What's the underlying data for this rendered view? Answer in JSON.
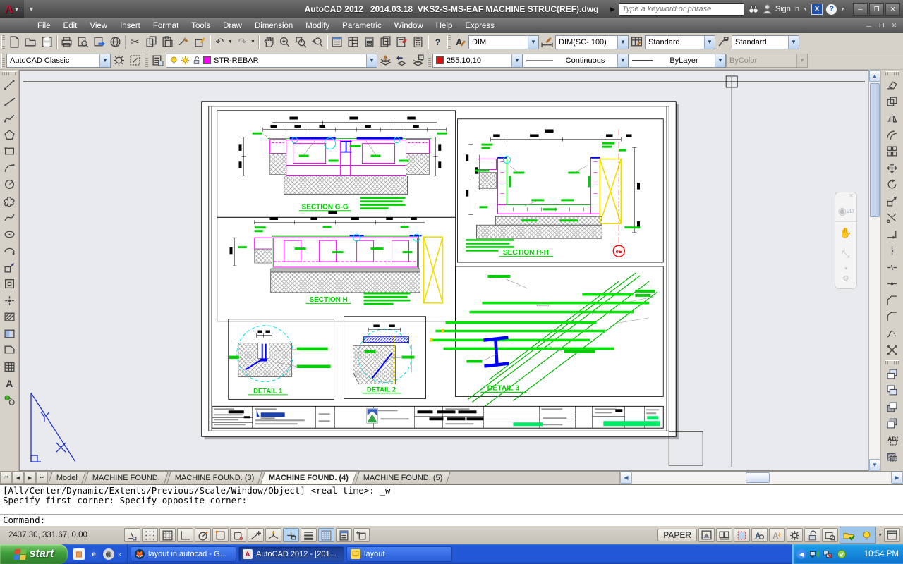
{
  "titlebar": {
    "app": "AutoCAD 2012",
    "doc": "2014.03.18_VKS2-S-MS-EAF MACHINE STRUC(REF).dwg",
    "search_placeholder": "Type a keyword or phrase",
    "sign_in": "Sign In"
  },
  "menu": {
    "items": [
      "File",
      "Edit",
      "View",
      "Insert",
      "Format",
      "Tools",
      "Draw",
      "Dimension",
      "Modify",
      "Parametric",
      "Window",
      "Help",
      "Express"
    ]
  },
  "toolbars": {
    "workspace": "AutoCAD Classic",
    "layer": "STR-REBAR",
    "color": "255,10,10",
    "linetype": "Continuous",
    "lineweight": "ByLayer",
    "plot_style": "ByColor",
    "text_style": "DIM",
    "dim_style": "DIM(SC- 100)",
    "table_style": "Standard",
    "mleader_style": "Standard"
  },
  "drawing": {
    "labels": {
      "section_gg": "SECTION G-G",
      "section_h": "SECTION H",
      "section_hh": "SECTION H-H",
      "detail_1": "DETAIL 1",
      "detail_2": "DETAIL 2",
      "detail_3": "DETAIL 3",
      "axis_bubble": "eE"
    },
    "colors": {
      "rebar_magenta": "#ff00ff",
      "outline_green": "#00c800",
      "steel_blue": "#0000ff",
      "brace_yellow": "#ffff00",
      "centerline_red": "#ff0000",
      "circle_cyan": "#00ffff"
    }
  },
  "tabs": {
    "items": [
      "Model",
      "MACHINE FOUND.",
      "MACHINE FOUND. (3)",
      "MACHINE FOUND. (4)",
      "MACHINE FOUND. (5)"
    ]
  },
  "command": {
    "line1": "[All/Center/Dynamic/Extents/Previous/Scale/Window/Object] <real time>: _w",
    "line2": "Specify first corner: Specify opposite corner:",
    "prompt": "Command:"
  },
  "statusbar": {
    "coords": "2437.30, 331.67, 0.00",
    "space_mode": "PAPER"
  },
  "taskbar": {
    "start": "start",
    "tasks": [
      "layout in autocad - G...",
      "AutoCAD 2012 - [201...",
      "layout"
    ],
    "time": "10:54 PM"
  }
}
